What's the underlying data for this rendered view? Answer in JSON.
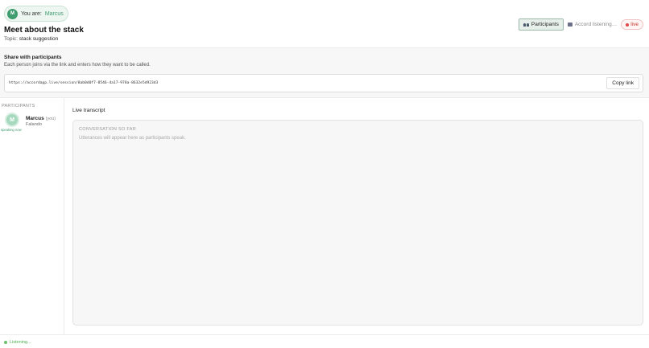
{
  "header": {
    "you_label": "You are:",
    "you_name": "Marcus",
    "you_initial": "M",
    "title": "Meet about the stack",
    "topic_label": "Topic:",
    "topic_value": "stack suggestion",
    "participants_button": "Participants",
    "listening_tag": "Accord listening…",
    "live_badge": "live"
  },
  "share": {
    "title": "Share with participants",
    "description": "Each person joins via the link and enters how they want to be called.",
    "link": "https://accordapp.live/session/8ab0d0f7-8546-4a17-978a-8632e5d923d3",
    "copy_button": "Copy link"
  },
  "sidebar": {
    "label": "PARTICIPANTS",
    "participants": [
      {
        "initial": "M",
        "name": "Marcus",
        "you_tag": "(you)",
        "status": "Falando",
        "speaking": "speaking now"
      }
    ]
  },
  "transcript": {
    "title": "Live transcript",
    "section_label": "CONVERSATION SO FAR",
    "empty_text": "Utterances will appear here as participants speak."
  },
  "footer": {
    "status": "Listening..."
  },
  "colors": {
    "accent": "#3f9c6e",
    "live": "#e04848",
    "listening": "#4caf50"
  },
  "icons": {
    "participants": "people-icon",
    "listening": "robot-icon"
  }
}
